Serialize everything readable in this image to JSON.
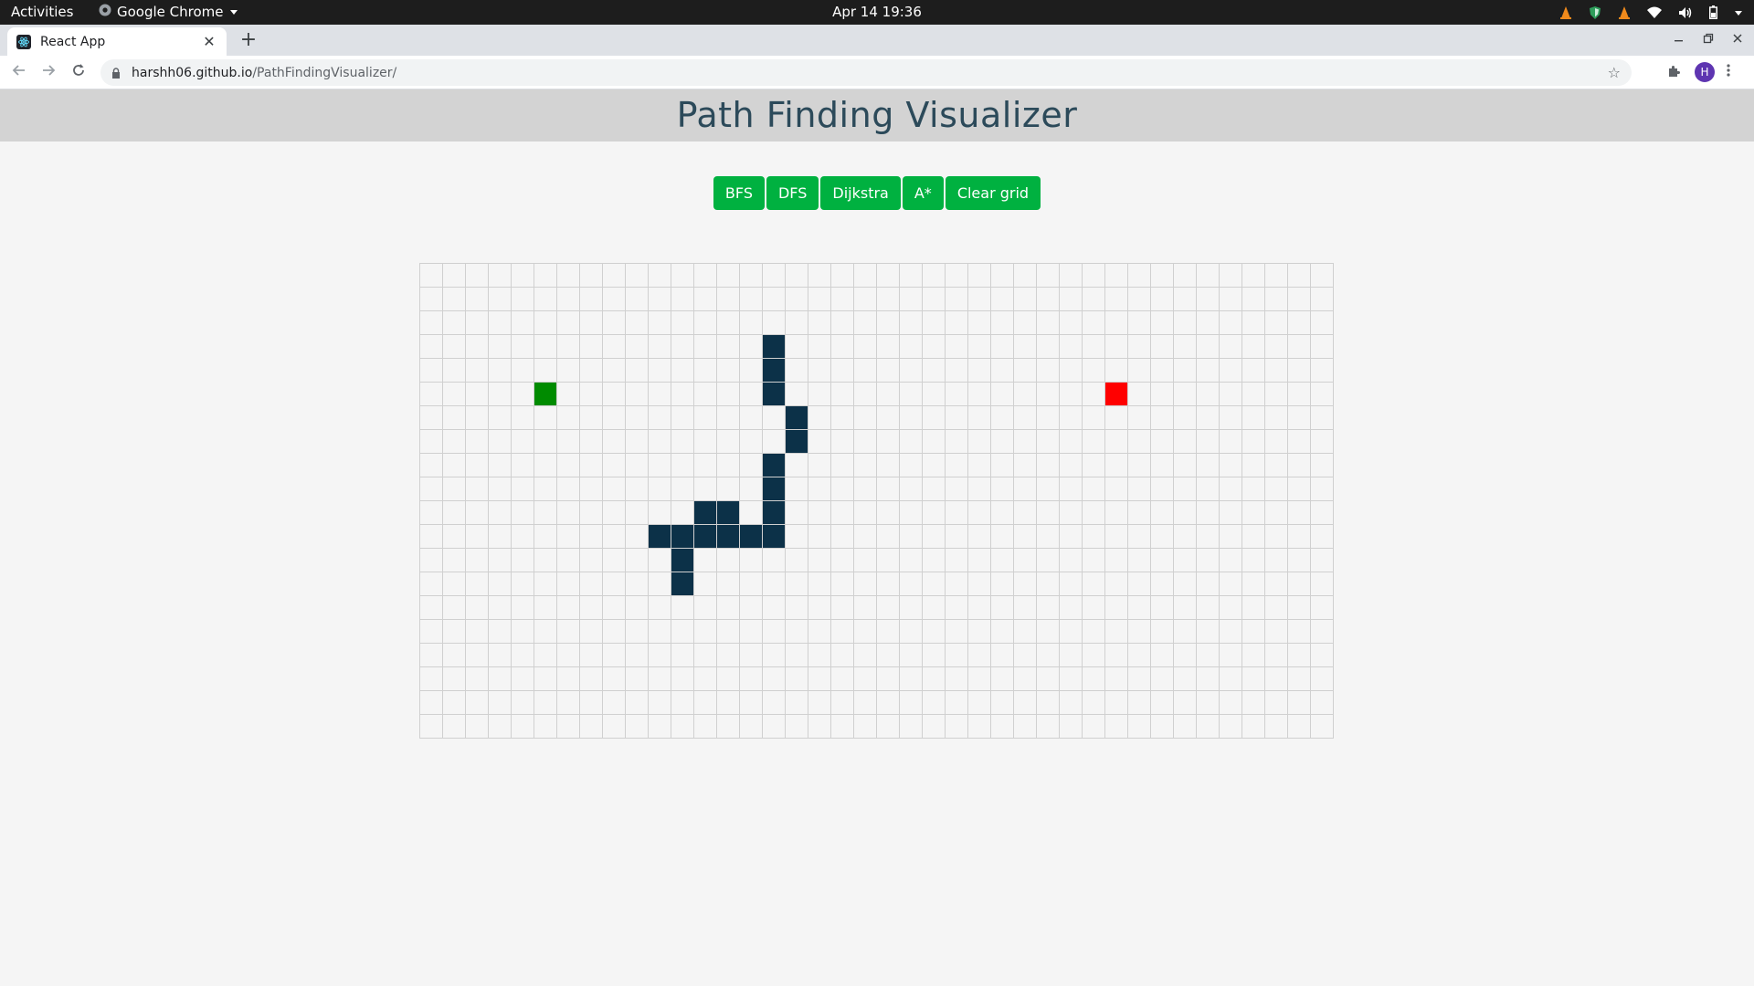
{
  "os": {
    "activities": "Activities",
    "app_name": "Google Chrome",
    "clock": "Apr 14  19:36"
  },
  "browser": {
    "tab_title": "React App",
    "url_host": "harshh06.github.io",
    "url_path": "/PathFindingVisualizer/",
    "avatar_letter": "H"
  },
  "page": {
    "title": "Path Finding Visualizer",
    "buttons": [
      "BFS",
      "DFS",
      "Dijkstra",
      "A*",
      "Clear grid"
    ]
  },
  "grid": {
    "rows": 20,
    "cols": 40,
    "start": [
      5,
      5
    ],
    "end": [
      5,
      30
    ],
    "walls": [
      [
        3,
        15
      ],
      [
        4,
        15
      ],
      [
        5,
        15
      ],
      [
        6,
        16
      ],
      [
        7,
        16
      ],
      [
        8,
        15
      ],
      [
        9,
        15
      ],
      [
        10,
        15
      ],
      [
        10,
        12
      ],
      [
        10,
        13
      ],
      [
        11,
        10
      ],
      [
        11,
        11
      ],
      [
        11,
        12
      ],
      [
        11,
        13
      ],
      [
        11,
        14
      ],
      [
        11,
        15
      ],
      [
        12,
        11
      ],
      [
        13,
        11
      ]
    ],
    "colors": {
      "wall": "#0c3148",
      "start": "#008b00",
      "end": "#ff0000",
      "button": "#00b140"
    }
  }
}
